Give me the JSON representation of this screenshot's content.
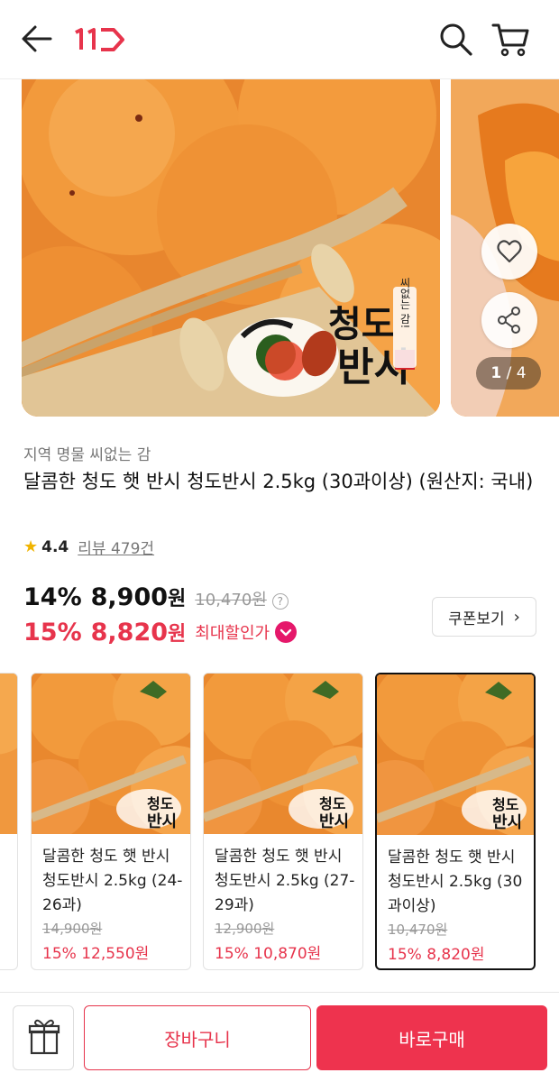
{
  "header": {
    "logo_text": "11",
    "icons": [
      "back-arrow-icon",
      "11st-logo",
      "search-icon",
      "cart-icon"
    ],
    "accent": "#e7344c"
  },
  "gallery": {
    "brand_line1": "청도",
    "brand_line2": "반시",
    "stamp_text": "씨없는 감!",
    "page_current": "1",
    "page_total": "/ 4"
  },
  "product": {
    "category": "지역 명물 씨없는 감",
    "title": "달콤한 청도 햇 반시 청도반시 2.5kg (30과이상) (원산지: 국내)",
    "rating": "4.4",
    "review": "리뷰 479건",
    "discount1": "14%",
    "price1": "8,900",
    "won": "원",
    "original_price": "10,470원",
    "help": "?",
    "discount2": "15%",
    "price2": "8,820",
    "max_discount_label": "최대할인가",
    "coupon_label": "쿠폰보기",
    "coupon_arrow": "›"
  },
  "options": [
    {
      "name": "달콤한 청도 햇 반시 청도반시 2.5kg (24-26과)",
      "original": "14,900원",
      "sale": "15% 12,550원"
    },
    {
      "name": "달콤한 청도 햇 반시 청도반시 2.5kg (27-29과)",
      "original": "12,900원",
      "sale": "15% 10,870원"
    },
    {
      "name": "달콤한 청도 햇 반시 청도반시 2.5kg (30과이상)",
      "original": "10,470원",
      "sale": "15% 8,820원"
    }
  ],
  "bottom": {
    "cart_label": "장바구니",
    "buy_label": "바로구매"
  },
  "colors": {
    "accent_red": "#e7344c",
    "buy_button": "#ee334e",
    "badge_pink": "#e5186a",
    "persimmon": "#f0983e"
  }
}
